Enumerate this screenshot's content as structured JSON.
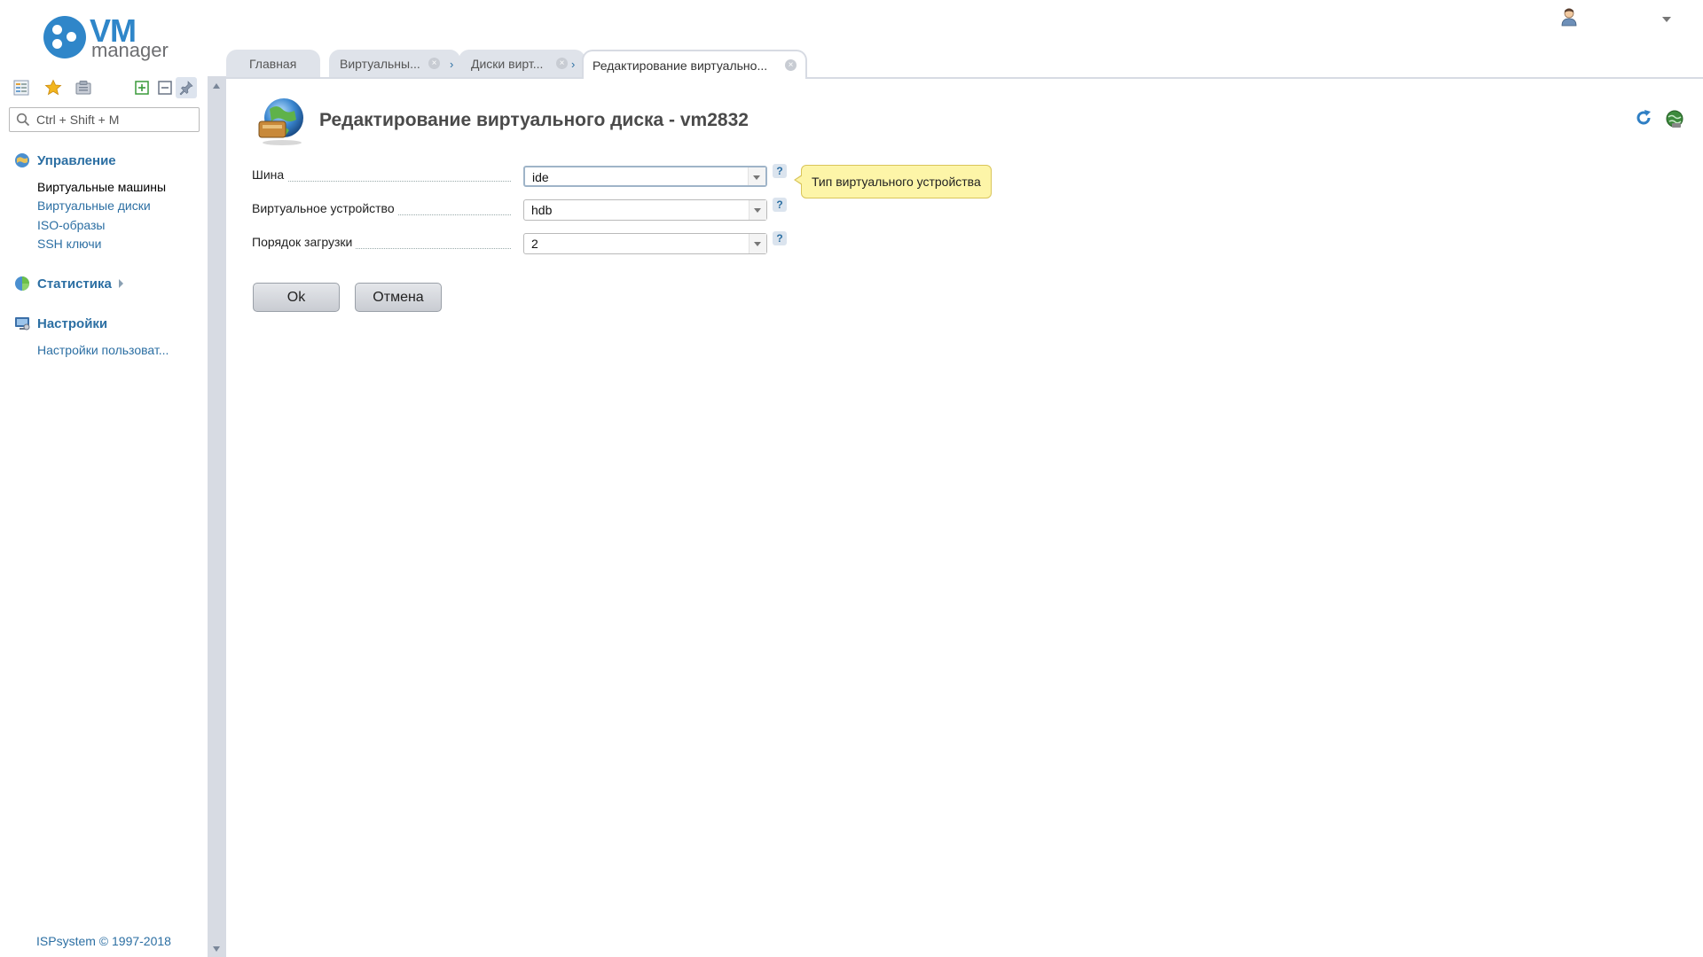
{
  "app": {
    "logo_vm": "VM",
    "logo_sub": "manager",
    "footer": "ISPsystem © 1997-2018"
  },
  "search": {
    "placeholder": "Ctrl + Shift + M"
  },
  "menu": {
    "groups": [
      {
        "title": "Управление",
        "items": [
          "Виртуальные машины",
          "Виртуальные диски",
          "ISO-образы",
          "SSH ключи"
        ]
      },
      {
        "title": "Статистика",
        "items": []
      },
      {
        "title": "Настройки",
        "items": [
          "Настройки пользоват..."
        ]
      }
    ]
  },
  "tabs": [
    {
      "label": "Главная"
    },
    {
      "label": "Виртуальны..."
    },
    {
      "label": "Диски вирт..."
    },
    {
      "label": "Редактирование виртуально..."
    }
  ],
  "page": {
    "title": "Редактирование виртуального диска - vm2832"
  },
  "form": {
    "fields": [
      {
        "label": "Шина",
        "value": "ide"
      },
      {
        "label": "Виртуальное устройство",
        "value": "hdb"
      },
      {
        "label": "Порядок загрузки",
        "value": "2"
      }
    ],
    "help_glyph": "?",
    "tooltip": "Тип виртуального устройства",
    "ok_label": "Ok",
    "cancel_label": "Отмена"
  },
  "colors": {
    "accent": "#2c6fa3",
    "logo_blue": "#2f86c9",
    "tooltip_bg": "#fdf5a8",
    "panel_gray": "#d7dbe3"
  }
}
